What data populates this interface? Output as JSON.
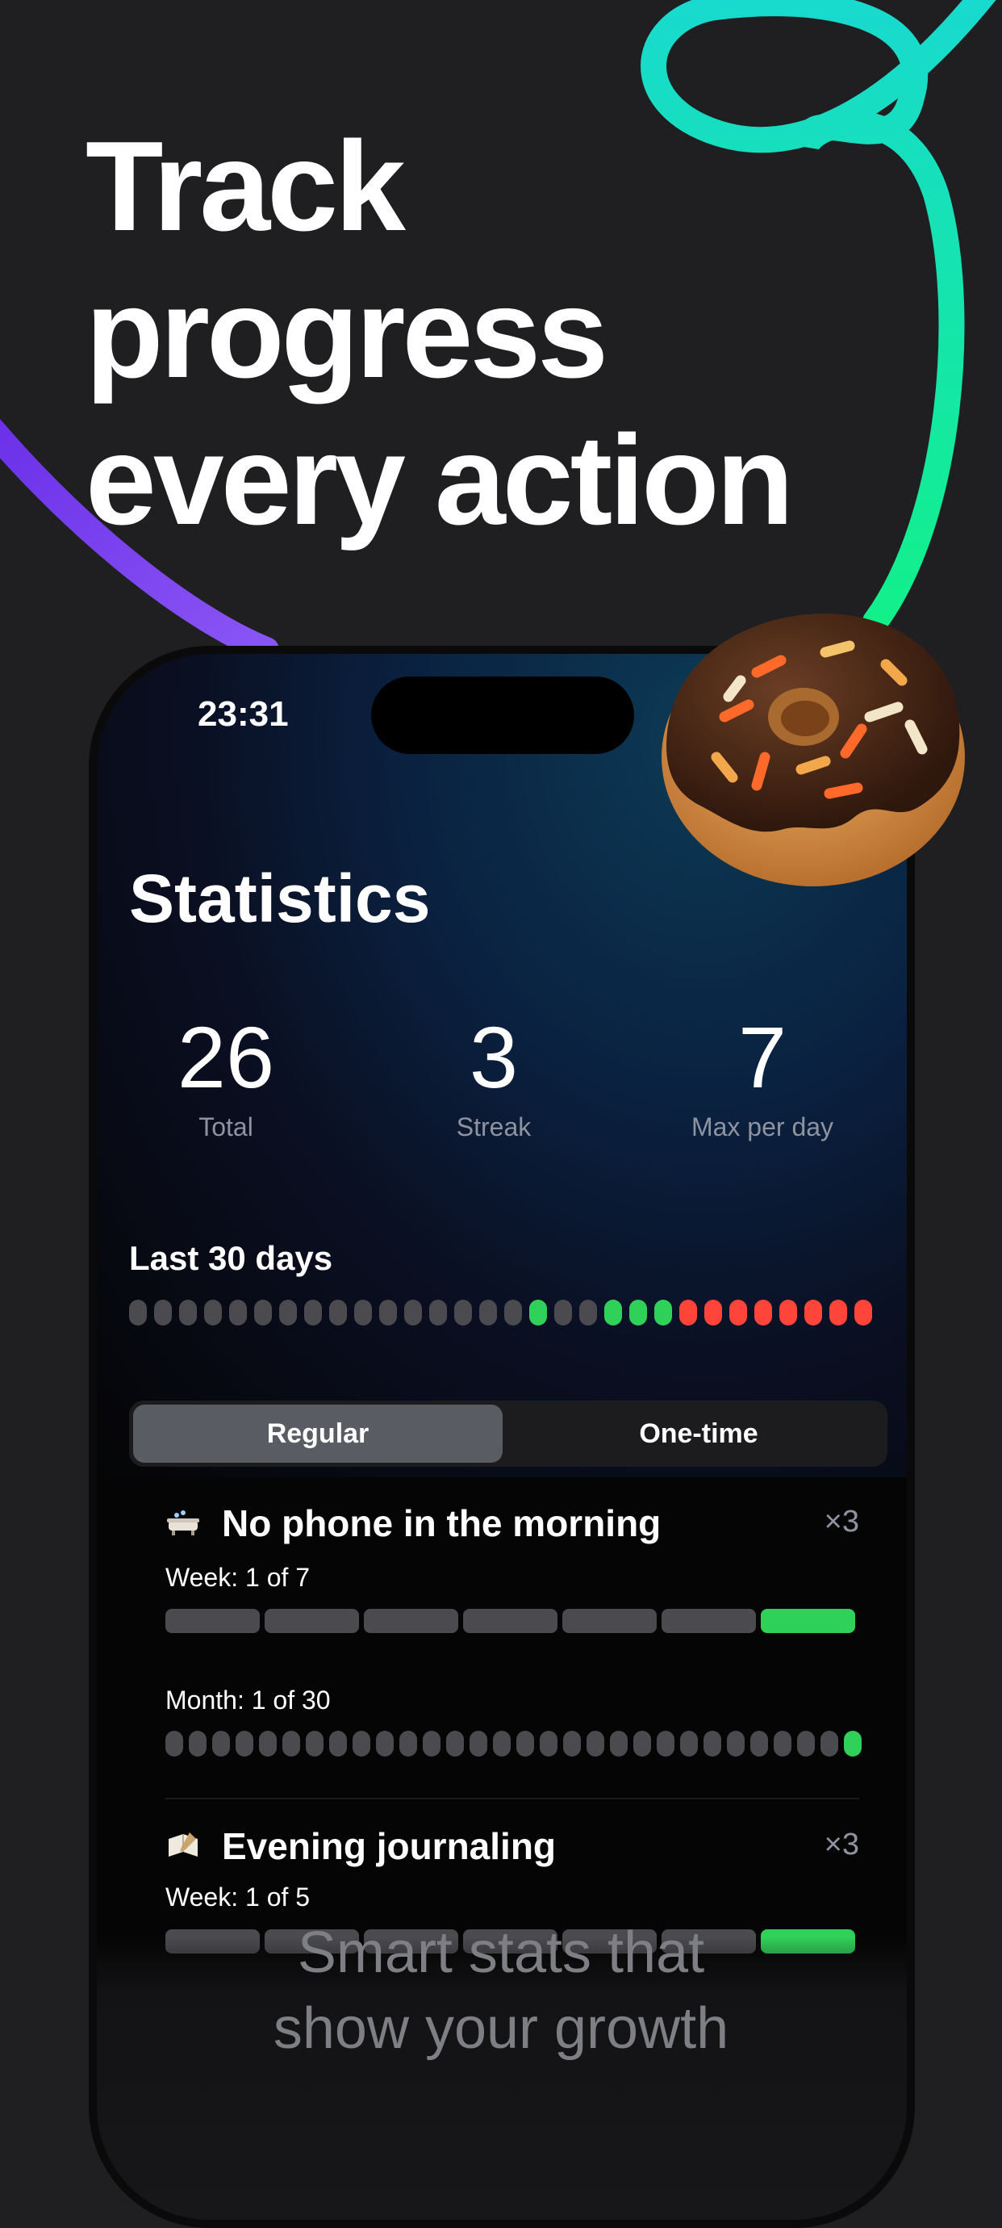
{
  "headline": {
    "line1": "Track",
    "line2": "progress",
    "line3": "every action"
  },
  "status_bar": {
    "time": "23:31"
  },
  "screen": {
    "title": "Statistics",
    "stats": [
      {
        "value": "26",
        "label": "Total"
      },
      {
        "value": "3",
        "label": "Streak"
      },
      {
        "value": "7",
        "label": "Max per day"
      }
    ],
    "last30": {
      "label": "Last 30 days",
      "days": [
        "empty",
        "empty",
        "empty",
        "empty",
        "empty",
        "empty",
        "empty",
        "empty",
        "empty",
        "empty",
        "empty",
        "empty",
        "empty",
        "empty",
        "empty",
        "empty",
        "green",
        "empty",
        "empty",
        "green",
        "green",
        "green",
        "red",
        "red",
        "red",
        "red",
        "red",
        "red",
        "red",
        "red"
      ]
    },
    "segmented": {
      "options": [
        "Regular",
        "One-time"
      ],
      "selected": "Regular"
    },
    "habits": [
      {
        "emoji_icon": "bathtub-icon",
        "name": "No phone in the morning",
        "multiplier": "×3",
        "week_label": "Week: 1 of 7",
        "week_done": 1,
        "week_total": 7,
        "month_label": "Month: 1 of 30",
        "month_done": 1,
        "month_total": 30
      },
      {
        "emoji_icon": "journal-icon",
        "name": "Evening journaling",
        "multiplier": "×3",
        "week_label": "Week: 1 of 5",
        "week_done": 1,
        "week_total": 5
      }
    ]
  },
  "caption": {
    "line1": "Smart stats that",
    "line2": "show your growth"
  },
  "colors": {
    "background": "#1f1f21",
    "green": "#30d158",
    "red": "#ff453a",
    "empty": "#4a4a4f",
    "swirl_purple": "#7b3cf0",
    "swirl_cyan": "#18e3c9",
    "swirl_green": "#12f08a"
  }
}
